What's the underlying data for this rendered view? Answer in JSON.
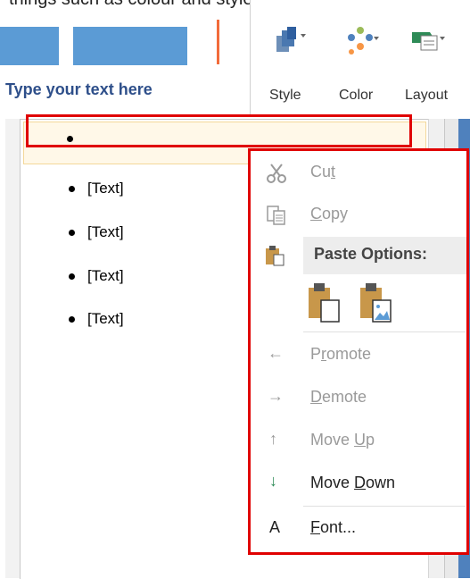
{
  "doc": {
    "caption": "things such as colour and style"
  },
  "ribbon": {
    "buttons": [
      {
        "label": "Style",
        "icon": "style-icon"
      },
      {
        "label": "Color",
        "icon": "color-icon"
      },
      {
        "label": "Layout",
        "icon": "layout-icon"
      }
    ]
  },
  "text_pane": {
    "header": "Type your text here",
    "bullets": [
      "",
      "[Text]",
      "[Text]",
      "[Text]",
      "[Text]"
    ]
  },
  "context_menu": {
    "items": [
      {
        "label_pre": "Cu",
        "label_u": "t",
        "label_post": "",
        "icon": "scissors-icon",
        "enabled": false
      },
      {
        "label_pre": "",
        "label_u": "C",
        "label_post": "opy",
        "icon": "copy-icon",
        "enabled": false
      },
      {
        "label_pre": "Paste Options:",
        "label_u": "",
        "label_post": "",
        "icon": "paste-icon",
        "enabled": true,
        "header": true
      },
      {
        "label_pre": "P",
        "label_u": "r",
        "label_post": "omote",
        "icon": "arrow-left-icon",
        "enabled": false
      },
      {
        "label_pre": "",
        "label_u": "D",
        "label_post": "emote",
        "icon": "arrow-right-icon",
        "enabled": false
      },
      {
        "label_pre": "Move ",
        "label_u": "U",
        "label_post": "p",
        "icon": "arrow-up-icon",
        "enabled": false
      },
      {
        "label_pre": "Move ",
        "label_u": "D",
        "label_post": "own",
        "icon": "arrow-down-icon",
        "enabled": true
      },
      {
        "label_pre": "",
        "label_u": "F",
        "label_post": "ont...",
        "icon": "font-icon",
        "enabled": true
      }
    ],
    "paste_option_icons": [
      "paste-keep-text-icon",
      "paste-picture-icon"
    ]
  },
  "colors": {
    "highlight_red": "#e00000",
    "shape_blue": "#5b9bd5",
    "header_blue": "#2e4f8a",
    "move_down_green": "#2e8b57"
  }
}
